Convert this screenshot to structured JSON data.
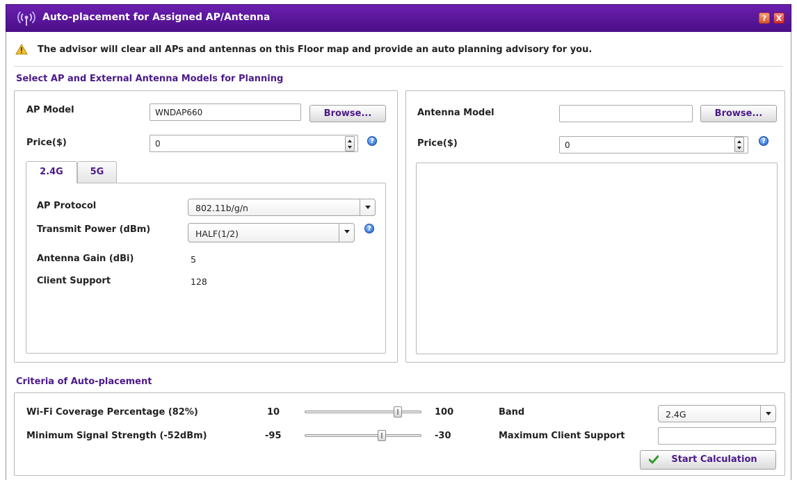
{
  "window": {
    "title": "Auto-placement for Assigned AP/Antenna",
    "help_glyph": "?",
    "close_glyph": "X"
  },
  "advisory": {
    "text": "The advisor will clear all APs and antennas on this Floor map and provide an auto planning advisory for you."
  },
  "models_section": {
    "title": "Select AP and External Antenna Models for Planning"
  },
  "ap_panel": {
    "model_label": "AP Model",
    "model_value": "WNDAP660",
    "browse_label": "Browse...",
    "price_label": "Price($)",
    "price_value": "0",
    "help_glyph": "?",
    "tabs": [
      {
        "label": "2.4G",
        "active": true
      },
      {
        "label": "5G",
        "active": false
      }
    ],
    "protocol_label": "AP Protocol",
    "protocol_value": "802.11b/g/n",
    "transmit_label": "Transmit Power (dBm)",
    "transmit_value": "HALF(1/2)",
    "gain_label": "Antenna Gain (dBi)",
    "gain_value": "5",
    "client_label": "Client Support",
    "client_value": "128"
  },
  "antenna_panel": {
    "model_label": "Antenna Model",
    "model_value": "",
    "browse_label": "Browse...",
    "price_label": "Price($)",
    "price_value": "0",
    "help_glyph": "?"
  },
  "criteria": {
    "title": "Criteria of Auto-placement",
    "coverage_label": "Wi-Fi Coverage Percentage (82%)",
    "coverage_min": "10",
    "coverage_max": "100",
    "coverage_level": 0.82,
    "signal_label": "Minimum Signal Strength (-52dBm)",
    "signal_min": "-95",
    "signal_max": "-30",
    "signal_level": -52,
    "band_label": "Band",
    "band_value": "2.4G",
    "max_client_label": "Maximum Client Support",
    "max_client_value": "",
    "start_label": "Start Calculation"
  },
  "colors": {
    "titlebar": "#5a1a9a",
    "accent_text": "#4b1a8a"
  }
}
